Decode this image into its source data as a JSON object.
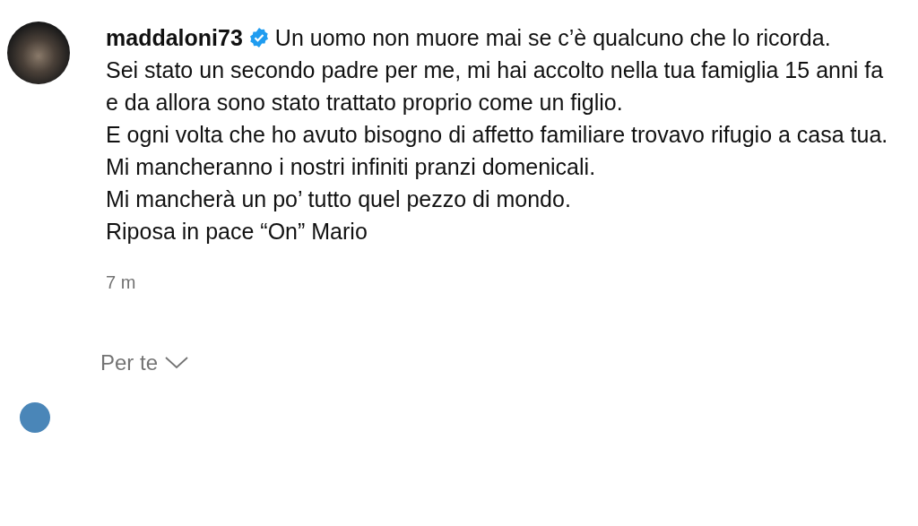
{
  "comment": {
    "username": "maddaloni73",
    "verified": true,
    "lines": [
      "Un uomo non muore mai se c’è qualcuno che lo ricorda.",
      "Sei stato un secondo padre per me, mi hai accolto nella tua famiglia 15 anni fa e da allora sono stato trattato proprio come un figlio.",
      "E ogni volta che ho avuto bisogno di affetto familiare trovavo rifugio a casa tua.",
      "Mi mancheranno i nostri infiniti pranzi domenicali.",
      "Mi mancherà un po’ tutto quel pezzo di mondo.",
      "Riposa in pace “On” Mario"
    ],
    "time": "7 m"
  },
  "sort": {
    "label": "Per te"
  }
}
